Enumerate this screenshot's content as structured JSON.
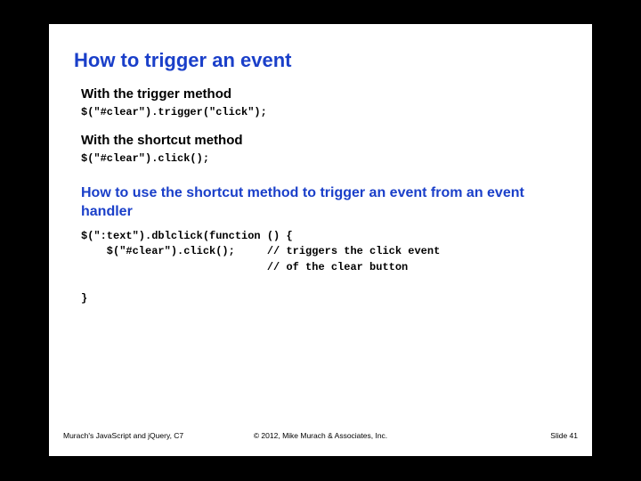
{
  "title": "How to trigger an event",
  "section1": {
    "heading": "With the trigger method",
    "code": "$(\"#clear\").trigger(\"click\");"
  },
  "section2": {
    "heading": "With the shortcut method",
    "code": "$(\"#clear\").click();"
  },
  "section3": {
    "heading": "How to use the shortcut method\nto trigger an event from an event handler",
    "code": "$(\":text\").dblclick(function () {\n    $(\"#clear\").click();     // triggers the click event\n                             // of the clear button\n\n}"
  },
  "footer": {
    "left": "Murach's JavaScript and jQuery, C7",
    "center": "© 2012, Mike Murach & Associates, Inc.",
    "right": "Slide 41"
  }
}
